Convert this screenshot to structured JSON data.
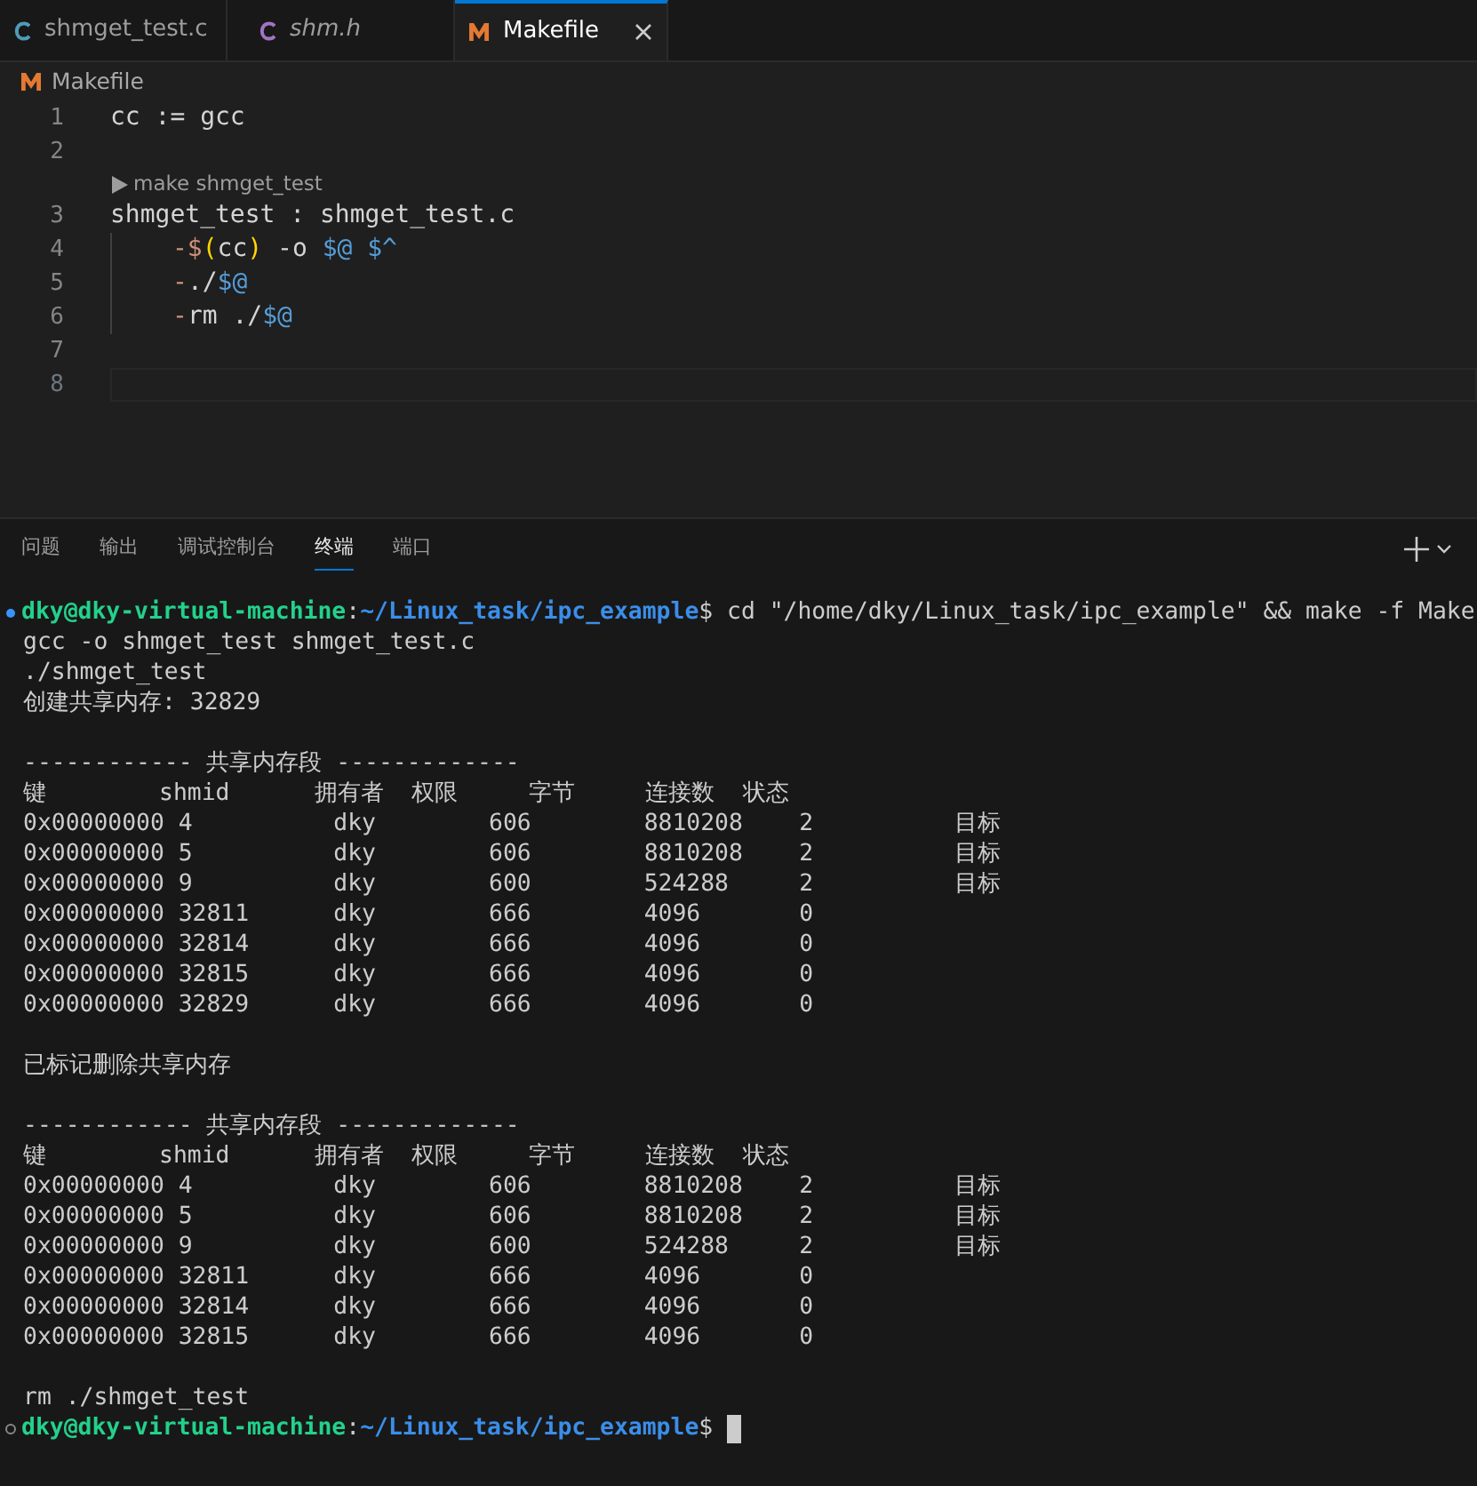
{
  "tabs": [
    {
      "label": "shmget_test.c",
      "kind": "c",
      "italic": false,
      "selected": false
    },
    {
      "label": "shm.h",
      "kind": "c",
      "italic": true,
      "selected": false
    },
    {
      "label": "Makefile",
      "kind": "m",
      "italic": false,
      "selected": true,
      "closable": true
    }
  ],
  "breadcrumb": {
    "label": "Makefile"
  },
  "editor": {
    "lines": [
      {
        "number": "1",
        "tokens": [
          {
            "text": "cc := gcc",
            "kind": "plain"
          }
        ]
      },
      {
        "number": "2"
      },
      {
        "codelens": "make shmget_test"
      },
      {
        "number": "3",
        "tokens": [
          {
            "text": "shmget_test : shmget_test.c",
            "kind": "plain"
          }
        ]
      },
      {
        "number": "4",
        "indent": true,
        "tokens": [
          {
            "text": "-$",
            "kind": "op"
          },
          {
            "text": "(",
            "kind": "paren"
          },
          {
            "text": "cc",
            "kind": "plain"
          },
          {
            "text": ")",
            "kind": "paren"
          },
          {
            "text": " -o ",
            "kind": "plain"
          },
          {
            "text": "$@ $^",
            "kind": "var"
          }
        ]
      },
      {
        "number": "5",
        "indent": true,
        "tokens": [
          {
            "text": "-",
            "kind": "op"
          },
          {
            "text": "./",
            "kind": "plain"
          },
          {
            "text": "$@",
            "kind": "var"
          }
        ]
      },
      {
        "number": "6",
        "indent": true,
        "tokens": [
          {
            "text": "-",
            "kind": "op"
          },
          {
            "text": "rm ./",
            "kind": "plain"
          },
          {
            "text": "$@",
            "kind": "var"
          }
        ]
      },
      {
        "number": "7"
      },
      {
        "number": "8",
        "current": true
      }
    ]
  },
  "panel": {
    "tabs": [
      {
        "label": "问题",
        "selected": false
      },
      {
        "label": "输出",
        "selected": false
      },
      {
        "label": "调试控制台",
        "selected": false
      },
      {
        "label": "终端",
        "selected": true
      },
      {
        "label": "端口",
        "selected": false
      }
    ]
  },
  "terminal": {
    "lines": [
      {
        "kind": "prompt",
        "user": "dky@dky-virtual-machine",
        "sep": ":",
        "path": "~/Linux_task/ipc_example",
        "command": "$ cd \"/home/dky/Linux_task/ipc_example\" && make -f Make"
      },
      {
        "kind": "text",
        "text": "gcc -o shmget_test shmget_test.c"
      },
      {
        "kind": "text",
        "text": "./shmget_test"
      },
      {
        "kind": "text",
        "text": "创建共享内存: 32829"
      },
      {
        "kind": "blank"
      },
      {
        "kind": "text",
        "text": "------------ 共享内存段 -------------"
      },
      {
        "kind": "text",
        "text": "键        shmid      拥有者  权限     字节     连接数  状态"
      },
      {
        "kind": "text",
        "text": "0x00000000 4          dky        606        8810208    2          目标"
      },
      {
        "kind": "text",
        "text": "0x00000000 5          dky        606        8810208    2          目标"
      },
      {
        "kind": "text",
        "text": "0x00000000 9          dky        600        524288     2          目标"
      },
      {
        "kind": "text",
        "text": "0x00000000 32811      dky        666        4096       0"
      },
      {
        "kind": "text",
        "text": "0x00000000 32814      dky        666        4096       0"
      },
      {
        "kind": "text",
        "text": "0x00000000 32815      dky        666        4096       0"
      },
      {
        "kind": "text",
        "text": "0x00000000 32829      dky        666        4096       0"
      },
      {
        "kind": "blank"
      },
      {
        "kind": "text",
        "text": "已标记删除共享内存"
      },
      {
        "kind": "blank"
      },
      {
        "kind": "text",
        "text": "------------ 共享内存段 -------------"
      },
      {
        "kind": "text",
        "text": "键        shmid      拥有者  权限     字节     连接数  状态"
      },
      {
        "kind": "text",
        "text": "0x00000000 4          dky        606        8810208    2          目标"
      },
      {
        "kind": "text",
        "text": "0x00000000 5          dky        606        8810208    2          目标"
      },
      {
        "kind": "text",
        "text": "0x00000000 9          dky        600        524288     2          目标"
      },
      {
        "kind": "text",
        "text": "0x00000000 32811      dky        666        4096       0"
      },
      {
        "kind": "text",
        "text": "0x00000000 32814      dky        666        4096       0"
      },
      {
        "kind": "text",
        "text": "0x00000000 32815      dky        666        4096       0"
      },
      {
        "kind": "blank"
      },
      {
        "kind": "text",
        "text": "rm ./shmget_test"
      },
      {
        "kind": "prompt",
        "user": "dky@dky-virtual-machine",
        "sep": ":",
        "path": "~/Linux_task/ipc_example",
        "command": "$ ",
        "cursor": true
      }
    ]
  }
}
